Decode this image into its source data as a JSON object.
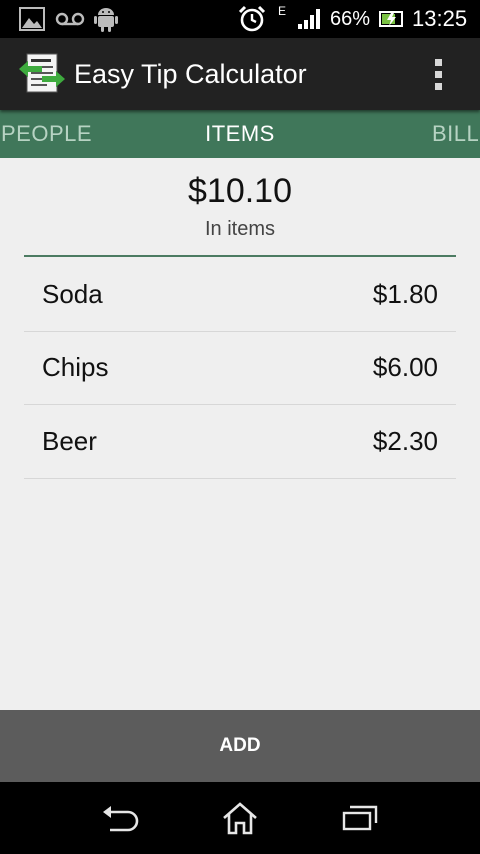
{
  "status_bar": {
    "network_label": "E",
    "battery": "66%",
    "time": "13:25",
    "icons": [
      "gallery-icon",
      "voicemail-icon",
      "android-icon",
      "alarm-icon",
      "signal-icon",
      "battery-icon"
    ]
  },
  "app": {
    "title": "Easy Tip Calculator",
    "icons": [
      "app-logo-icon",
      "overflow-menu-icon"
    ]
  },
  "tabs": {
    "people": "PEOPLE",
    "items": "ITEMS",
    "bill": "BILL",
    "selected": "ITEMS"
  },
  "summary": {
    "total": "$10.10",
    "label": "In items"
  },
  "items": [
    {
      "name": "Soda",
      "price": "$1.80"
    },
    {
      "name": "Chips",
      "price": "$6.00"
    },
    {
      "name": "Beer",
      "price": "$2.30"
    }
  ],
  "add_button": "ADD",
  "nav_icons": [
    "back-icon",
    "home-icon",
    "recent-apps-icon"
  ],
  "colors": {
    "tab_strip": "#40775a",
    "action_bar": "#222222",
    "add_bar": "#5c5c5c",
    "background": "#efefef"
  }
}
